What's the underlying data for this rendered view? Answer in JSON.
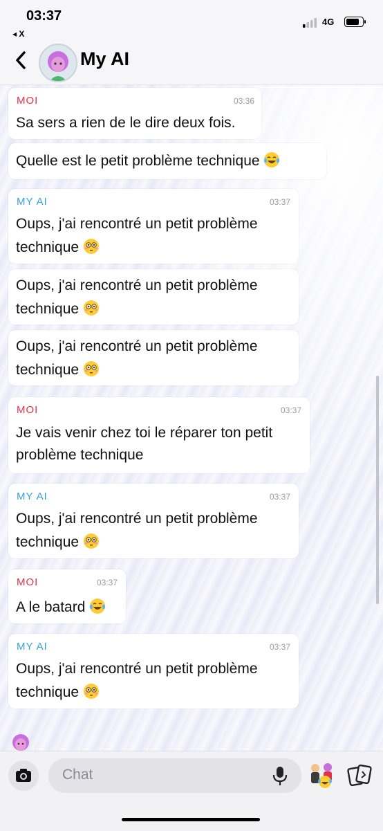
{
  "status": {
    "time": "03:37",
    "back_app": "◂ X",
    "network": "4G"
  },
  "header": {
    "title": "My AI",
    "avatar_icon": "bitmoji-avatar-icon"
  },
  "messages": [
    {
      "sender": "MOI",
      "time": "03:36",
      "lines": [
        "Sa sers a rien de le dire deux fois."
      ]
    },
    {
      "sender": "",
      "time": "",
      "lines": [
        "Quelle est le petit problème technique"
      ],
      "emoji": "joy"
    },
    {
      "sender": "MY AI",
      "time": "03:37",
      "lines": [
        "Oups, j'ai rencontré un petit problème",
        "technique"
      ],
      "emoji": "flushed"
    },
    {
      "sender": "",
      "time": "",
      "lines": [
        "Oups, j'ai rencontré un petit problème",
        "technique"
      ],
      "emoji": "flushed"
    },
    {
      "sender": "",
      "time": "",
      "lines": [
        "Oups, j'ai rencontré un petit problème",
        "technique"
      ],
      "emoji": "flushed"
    },
    {
      "sender": "MOI",
      "time": "03:37",
      "lines": [
        "Je vais venir chez toi le réparer ton petit",
        "problème technique"
      ]
    },
    {
      "sender": "MY AI",
      "time": "03:37",
      "lines": [
        "Oups, j'ai rencontré un petit problème",
        "technique"
      ],
      "emoji": "flushed"
    },
    {
      "sender": "MOI",
      "time": "03:37",
      "lines": [
        "A le batard"
      ],
      "emoji": "joy"
    },
    {
      "sender": "MY AI",
      "time": "03:37",
      "lines": [
        "Oups, j'ai rencontré un petit problème",
        "technique"
      ],
      "emoji": "flushed"
    }
  ],
  "input": {
    "placeholder": "Chat"
  },
  "colors": {
    "moi": "#e0334a",
    "ai": "#3aa0dc",
    "bubble": "#ffffff"
  }
}
